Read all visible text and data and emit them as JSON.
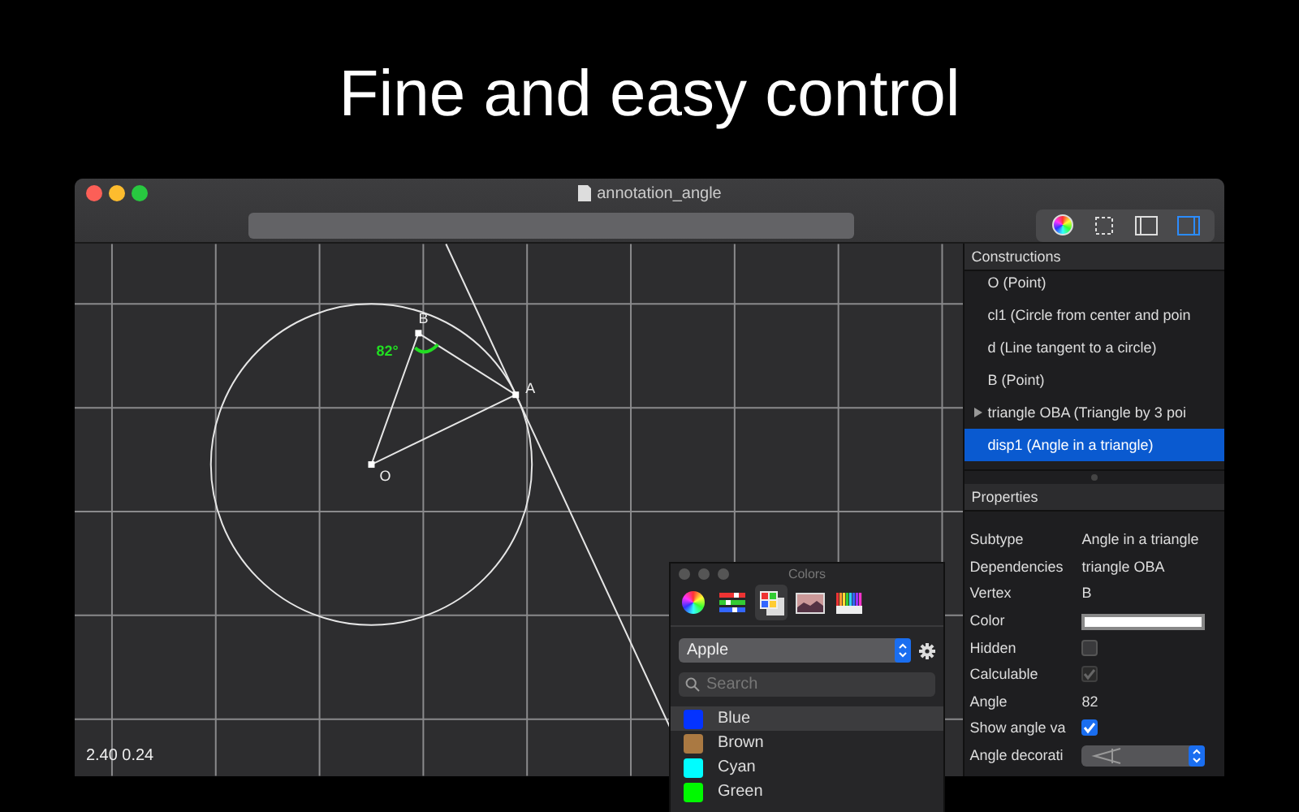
{
  "headline": "Fine and easy control",
  "window": {
    "title": "annotation_angle"
  },
  "toolbar": {
    "buttons": [
      {
        "kind": "color-wheel",
        "selected": false
      },
      {
        "kind": "selection",
        "selected": false
      },
      {
        "kind": "sidebar-left",
        "selected": false
      },
      {
        "kind": "sidebar-right",
        "selected": true
      }
    ]
  },
  "canvas": {
    "points": [
      {
        "label": "O"
      },
      {
        "label": "B"
      },
      {
        "label": "A"
      }
    ],
    "angle_label": "82°",
    "coordinates": "2.40 0.24"
  },
  "constructions": {
    "title": "Constructions",
    "items": [
      {
        "label": "O (Point)",
        "kind": "leaf",
        "selected": false
      },
      {
        "label": "cl1 (Circle from center and poin",
        "kind": "leaf",
        "selected": false
      },
      {
        "label": "d (Line tangent to a circle)",
        "kind": "leaf",
        "selected": false
      },
      {
        "label": "B (Point)",
        "kind": "leaf",
        "selected": false
      },
      {
        "label": "triangle OBA (Triangle by 3 poi",
        "kind": "group",
        "selected": false
      },
      {
        "label": "disp1 (Angle in a triangle)",
        "kind": "leaf",
        "selected": true
      }
    ]
  },
  "properties": {
    "title": "Properties",
    "rows": [
      {
        "label": "Subtype",
        "kind": "text",
        "value": "Angle in a triangle"
      },
      {
        "label": "Dependencies",
        "kind": "text",
        "value": "triangle OBA"
      },
      {
        "label": "Vertex",
        "kind": "text",
        "value": "B"
      },
      {
        "label": "Color",
        "kind": "color",
        "color": "#ffffff"
      },
      {
        "label": "Hidden",
        "kind": "checkbox",
        "checked": false,
        "disabled": false
      },
      {
        "label": "Calculable",
        "kind": "checkbox",
        "checked": true,
        "disabled": true
      },
      {
        "label": "Angle",
        "kind": "text",
        "value": "82"
      },
      {
        "label": "Show angle va",
        "kind": "checkbox",
        "checked": true,
        "disabled": false
      },
      {
        "label": "Angle decorati",
        "kind": "select"
      }
    ]
  },
  "colors_panel": {
    "title": "Colors",
    "tabs": [
      {
        "kind": "wheel",
        "selected": false
      },
      {
        "kind": "sliders",
        "selected": false
      },
      {
        "kind": "palettes",
        "selected": true
      },
      {
        "kind": "image",
        "selected": false
      },
      {
        "kind": "pencils",
        "selected": false
      }
    ],
    "palette": "Apple",
    "search": {
      "placeholder": "Search"
    },
    "swatches": [
      {
        "name": "Blue",
        "color": "#0433ff",
        "selected": true
      },
      {
        "name": "Brown",
        "color": "#aa7942",
        "selected": false
      },
      {
        "name": "Cyan",
        "color": "#00fdff",
        "selected": false
      },
      {
        "name": "Green",
        "color": "#00f900",
        "selected": false
      }
    ]
  }
}
